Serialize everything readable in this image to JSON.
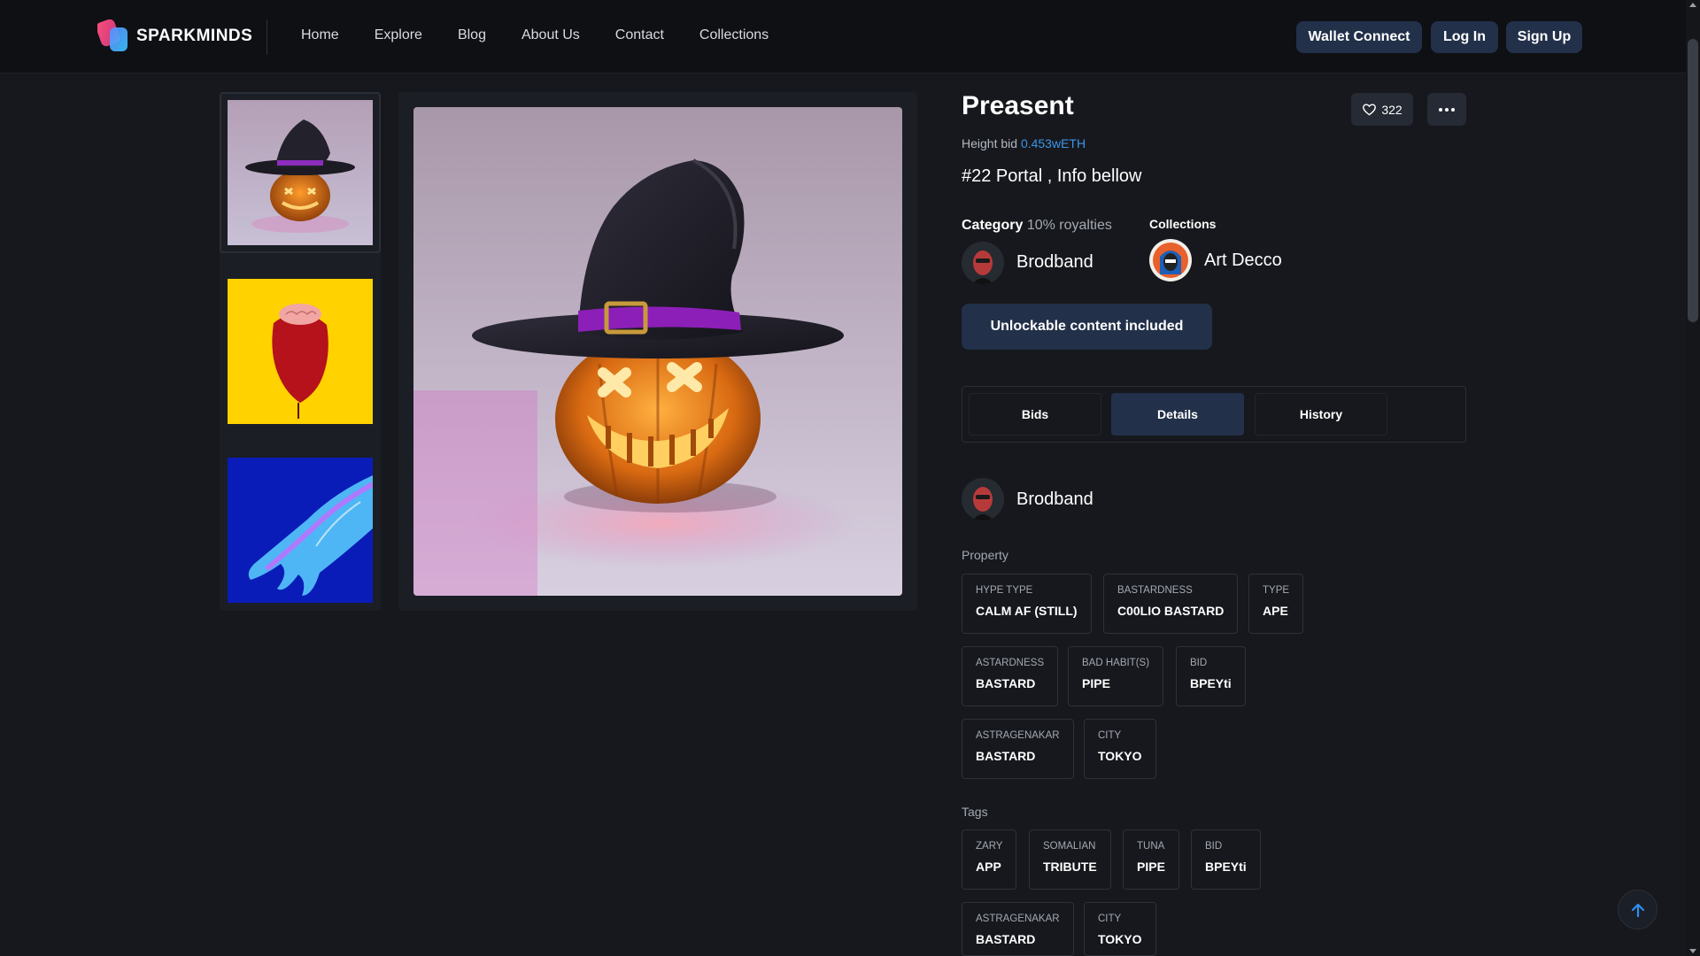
{
  "header": {
    "brand": "SPARKMINDS",
    "nav": [
      "Home",
      "Explore",
      "Blog",
      "About Us",
      "Contact",
      "Collections"
    ],
    "wallet_connect": "Wallet Connect",
    "login": "Log In",
    "signup": "Sign Up"
  },
  "item": {
    "title": "Preasent",
    "likes": "322",
    "bid_label": "Height bid",
    "bid_value": "0.453wETH",
    "subtitle": "#22 Portal , Info bellow",
    "category_label": "Category",
    "royalties": "10% royalties",
    "collections_label": "Collections",
    "creator_name": "Brodband",
    "collection_name": "Art Decco",
    "unlock_button": "Unlockable content included"
  },
  "tabs": [
    "Bids",
    "Details",
    "History"
  ],
  "details": {
    "owner_name": "Brodband",
    "property_label": "Property",
    "properties": [
      {
        "k": "HYPE TYPE",
        "v": "CALM AF (STILL)"
      },
      {
        "k": "BASTARDNESS",
        "v": "C00LIO BASTARD"
      },
      {
        "k": "TYPE",
        "v": "APE"
      },
      {
        "k": "ASTARDNESS",
        "v": "BASTARD"
      },
      {
        "k": "BAD HABIT(S)",
        "v": "PIPE"
      },
      {
        "k": "BID",
        "v": "BPEYti"
      },
      {
        "k": "ASTRAGENAKAR",
        "v": "BASTARD"
      },
      {
        "k": "CITY",
        "v": "TOKYO"
      }
    ],
    "tags_label": "Tags",
    "tags": [
      {
        "k": "ZARY",
        "v": "APP"
      },
      {
        "k": "SOMALIAN",
        "v": "TRIBUTE"
      },
      {
        "k": "TUNA",
        "v": "PIPE"
      },
      {
        "k": "BID",
        "v": "BPEYti"
      },
      {
        "k": "ASTRAGENAKAR",
        "v": "BASTARD"
      },
      {
        "k": "CITY",
        "v": "TOKYO"
      }
    ]
  },
  "colors": {
    "background": "#16181d",
    "header": "#0e1014",
    "button": "#223049",
    "accent_link": "#3e95e8"
  },
  "icons": [
    "logo-icon",
    "heart-icon",
    "more-dots-icon",
    "arrow-up-icon"
  ]
}
